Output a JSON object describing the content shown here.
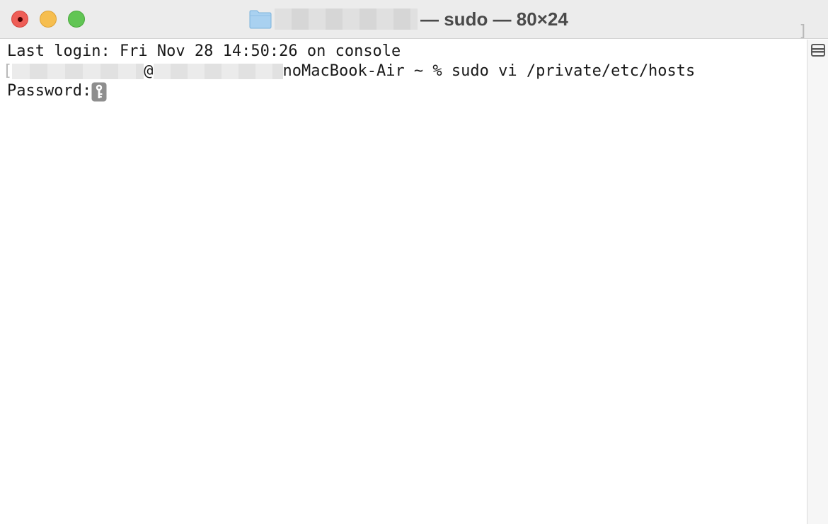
{
  "window": {
    "title_suffix": "— sudo — 80×24",
    "folder_icon": "folder-icon"
  },
  "terminal": {
    "line1": "Last login: Fri Nov 28 14:50:26 on console",
    "line2_at": "@",
    "line2_rest": "noMacBook-Air ~ % sudo vi /private/etc/hosts",
    "line3": "Password:",
    "left_bracket": "[",
    "right_bracket": "]",
    "password_icon": "key-icon"
  },
  "controls": {
    "close": "close-button",
    "minimize": "minimize-button",
    "zoom": "zoom-button",
    "split": "split-pane-button"
  },
  "colors": {
    "close": "#ee5e57",
    "minimize": "#f6be4f",
    "zoom": "#61c554",
    "titlebar": "#ececec",
    "text": "#1a1a1a"
  }
}
